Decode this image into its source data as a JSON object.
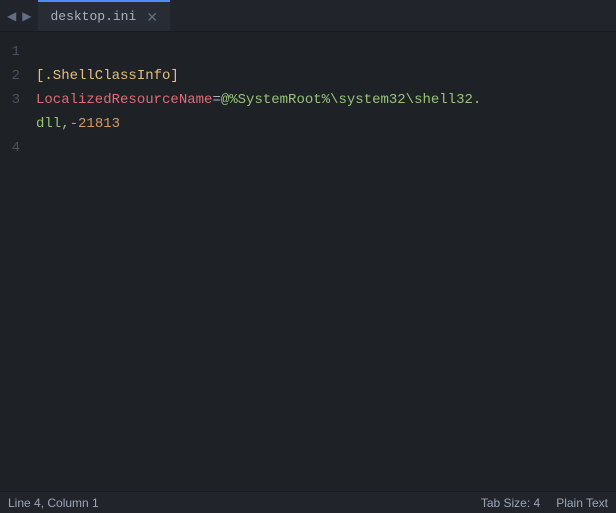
{
  "tabBar": {
    "leftArrow": "◀",
    "rightArrow": "▶",
    "tab": {
      "title": "desktop.ini",
      "closeIcon": "✕"
    }
  },
  "editor": {
    "lines": [
      {
        "number": "1",
        "content": ""
      },
      {
        "number": "2",
        "content": "[.ShellClassInfo]"
      },
      {
        "number": "3",
        "content": "LocalizedResourceName=@%SystemRoot%\\system32\\shell32.dll,-21813"
      },
      {
        "number": "4",
        "content": ""
      }
    ]
  },
  "statusBar": {
    "position": "Line 4, Column 1",
    "tabSize": "Tab Size: 4",
    "language": "Plain Text"
  },
  "colors": {
    "background": "#1e2227",
    "tabBarBg": "#21252b",
    "activeTab": "#282c34",
    "activeTabBorder": "#528bff",
    "lineNumberColor": "#495162",
    "textColor": "#abb2bf",
    "sectionColor": "#e5c07b",
    "keyColor": "#e06c75",
    "valueColor": "#98c379",
    "numberColor": "#d19a66",
    "statusBg": "#21252b"
  }
}
